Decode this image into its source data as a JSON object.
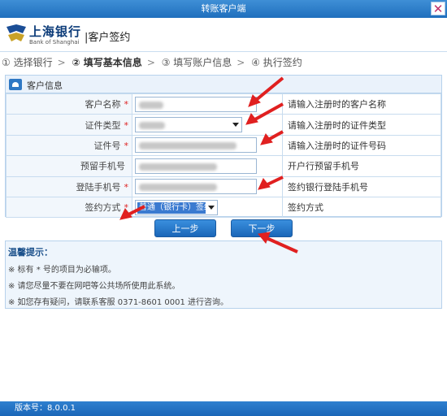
{
  "window": {
    "title": "转账客户端",
    "close_label": "✕"
  },
  "header": {
    "bank_cn": "上海银行",
    "bank_en": "Bank of Shanghai",
    "title": "|客户签约"
  },
  "steps": [
    {
      "label": "① 选择银行"
    },
    {
      "label": "② 填写基本信息"
    },
    {
      "label": "③ 填写账户信息"
    },
    {
      "label": "④ 执行签约"
    }
  ],
  "panel": {
    "title": "客户信息",
    "rows": [
      {
        "label": "客户名称",
        "required": "*",
        "hint": "请输入注册时的客户名称"
      },
      {
        "label": "证件类型",
        "required": "*",
        "hint": "请输入注册时的证件类型"
      },
      {
        "label": "证件号",
        "required": "*",
        "hint": "请输入注册时的证件号码"
      },
      {
        "label": "预留手机号",
        "required": "",
        "hint": "开户行预留手机号"
      },
      {
        "label": "登陆手机号",
        "required": "*",
        "hint": "签约银行登陆手机号"
      },
      {
        "label": "签约方式",
        "required": "*",
        "hint": "签约方式"
      }
    ],
    "sign_method_value": "普通（银行卡）签约"
  },
  "buttons": {
    "prev": "上一步",
    "next": "下一步"
  },
  "tips": {
    "title": "温馨提示：",
    "items": [
      "※ 标有 * 号的项目为必输项。",
      "※ 请您尽量不要在网吧等公共场所使用此系统。",
      "※ 如您存有疑问，请联系客服 0371-8601 0001 进行咨询。"
    ]
  },
  "footer": {
    "version": "版本号：8.0.0.1"
  },
  "colors": {
    "accent": "#1f6fbd",
    "arrow": "#e02020"
  }
}
